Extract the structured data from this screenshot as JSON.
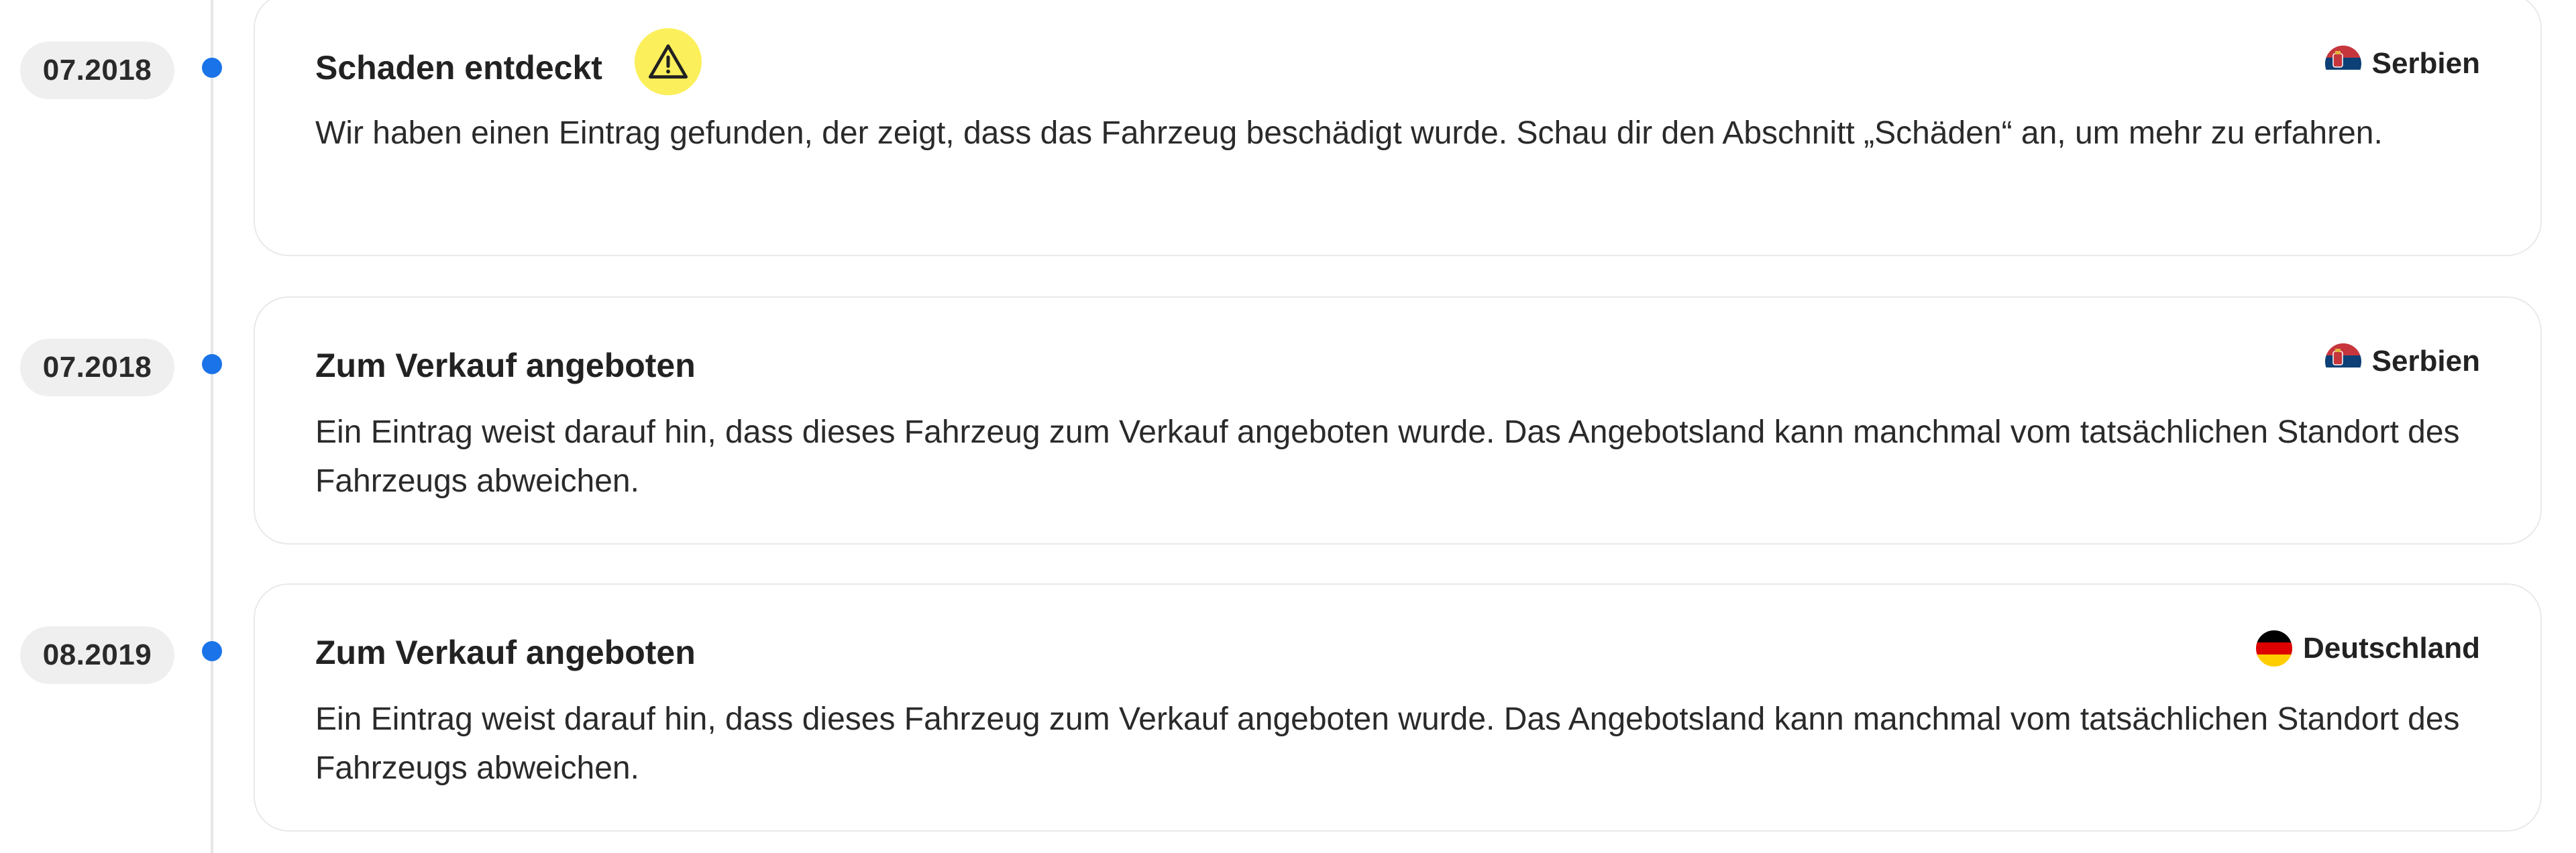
{
  "timeline": {
    "entries": [
      {
        "date": "07.2018",
        "title": "Schaden entdeckt",
        "has_warning": true,
        "country": "Serbien",
        "flag": "serbia-flag-icon",
        "description": "Wir haben einen Eintrag gefunden, der zeigt, dass das Fahrzeug beschädigt wurde. Schau dir den Abschnitt „Schäden“ an, um mehr zu erfahren."
      },
      {
        "date": "07.2018",
        "title": "Zum Verkauf angeboten",
        "has_warning": false,
        "country": "Serbien",
        "flag": "serbia-flag-icon",
        "description": "Ein Eintrag weist darauf hin, dass dieses Fahrzeug zum Verkauf angeboten wurde. Das Angebotsland kann manchmal vom tatsächlichen Standort des Fahrzeugs abweichen."
      },
      {
        "date": "08.2019",
        "title": "Zum Verkauf angeboten",
        "has_warning": false,
        "country": "Deutschland",
        "flag": "germany-flag-icon",
        "description": "Ein Eintrag weist darauf hin, dass dieses Fahrzeug zum Verkauf angeboten wurde. Das Angebotsland kann manchmal vom tatsächlichen Standort des Fahrzeugs abweichen."
      }
    ]
  },
  "colors": {
    "dot": "#1a73e8",
    "warning_badge": "#fbef5b",
    "badge_bg": "#efefef",
    "card_border": "#e9e9e9"
  }
}
